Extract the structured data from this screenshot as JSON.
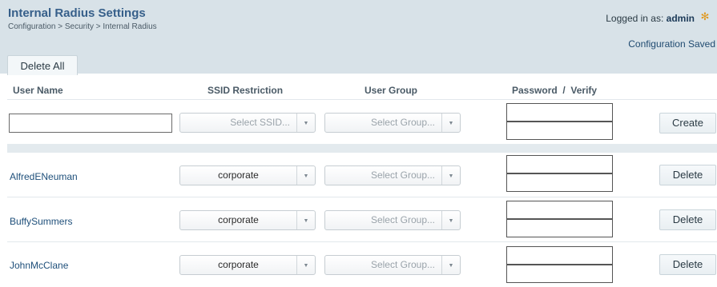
{
  "header": {
    "title": "Internal Radius Settings",
    "breadcrumb": "Configuration > Security > Internal Radius",
    "logged_in_prefix": "Logged in as:",
    "username": "admin",
    "status": "Configuration Saved"
  },
  "toolbar": {
    "delete_all_label": "Delete All"
  },
  "columns": {
    "user_name": "User Name",
    "ssid": "SSID Restriction",
    "group": "User Group",
    "password": "Password",
    "slash": "/",
    "verify": "Verify"
  },
  "new_user": {
    "username_value": "",
    "ssid_placeholder": "Select SSID...",
    "group_placeholder": "Select Group...",
    "create_label": "Create"
  },
  "users": [
    {
      "name": "AlfredENeuman",
      "ssid": "corporate",
      "group": "Select Group...",
      "action": "Delete"
    },
    {
      "name": "BuffySummers",
      "ssid": "corporate",
      "group": "Select Group...",
      "action": "Delete"
    },
    {
      "name": "JohnMcClane",
      "ssid": "corporate",
      "group": "Select Group...",
      "action": "Delete"
    }
  ],
  "colors": {
    "title": "#365f8a",
    "header_bg": "#d8e2e8",
    "link": "#1e4f7a",
    "gear": "#e0961a"
  },
  "icons": {
    "settings": "gear-icon",
    "dropdown": "chevron-down-icon"
  }
}
